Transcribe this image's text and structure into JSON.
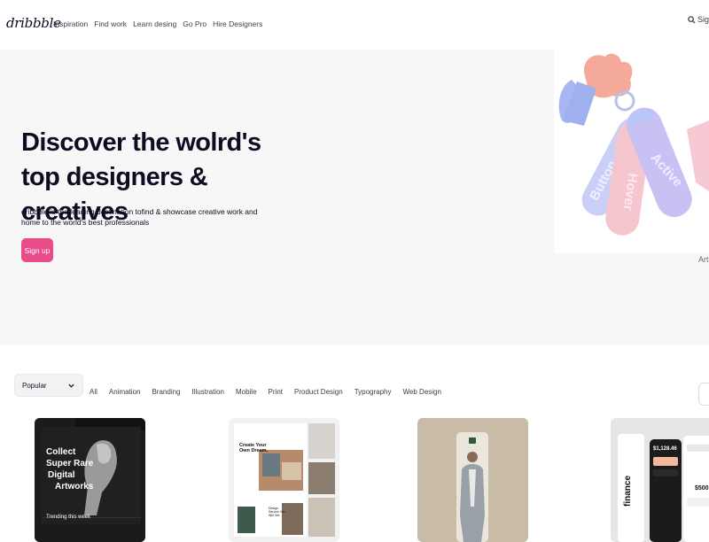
{
  "header": {
    "logo": "dribbble",
    "nav": [
      "Inspiration",
      "Find work",
      "Learn desing",
      "Go Pro",
      "Hire Designers"
    ],
    "signin_label": "Sign"
  },
  "hero": {
    "title": "Discover the wolrd's top designers & creatives",
    "subtitle": "dribbble is the leading destination tofind & showcase creative work and home to the world's best professionals",
    "signup_label": "Sign up",
    "art_caption": "Art",
    "art_tags": [
      "Button",
      "Hover",
      "Active"
    ]
  },
  "filters": {
    "sort_selected": "Popular",
    "categories": [
      "All",
      "Animation",
      "Branding",
      "Illustration",
      "Mobile",
      "Print",
      "Product Design",
      "Typography",
      "Web Design"
    ]
  },
  "shots": [
    {
      "title_lines": [
        "Collect",
        "Super Rare",
        "Digital",
        "Artworks"
      ],
      "caption": "Trending this week"
    },
    {
      "title_lines": [
        "Create Your",
        "Own Dream."
      ],
      "caption": "Design Service You Will Get."
    },
    {},
    {
      "brand": "finance",
      "amount": "$1,128.46",
      "amount2": "$500"
    }
  ],
  "colors": {
    "brand_pink": "#ea4c89",
    "hero_bg": "#f8f7f8",
    "text_dark": "#0d0c22"
  },
  "icons": {
    "search": "search-icon",
    "dropdown": "chevron-down-icon"
  }
}
